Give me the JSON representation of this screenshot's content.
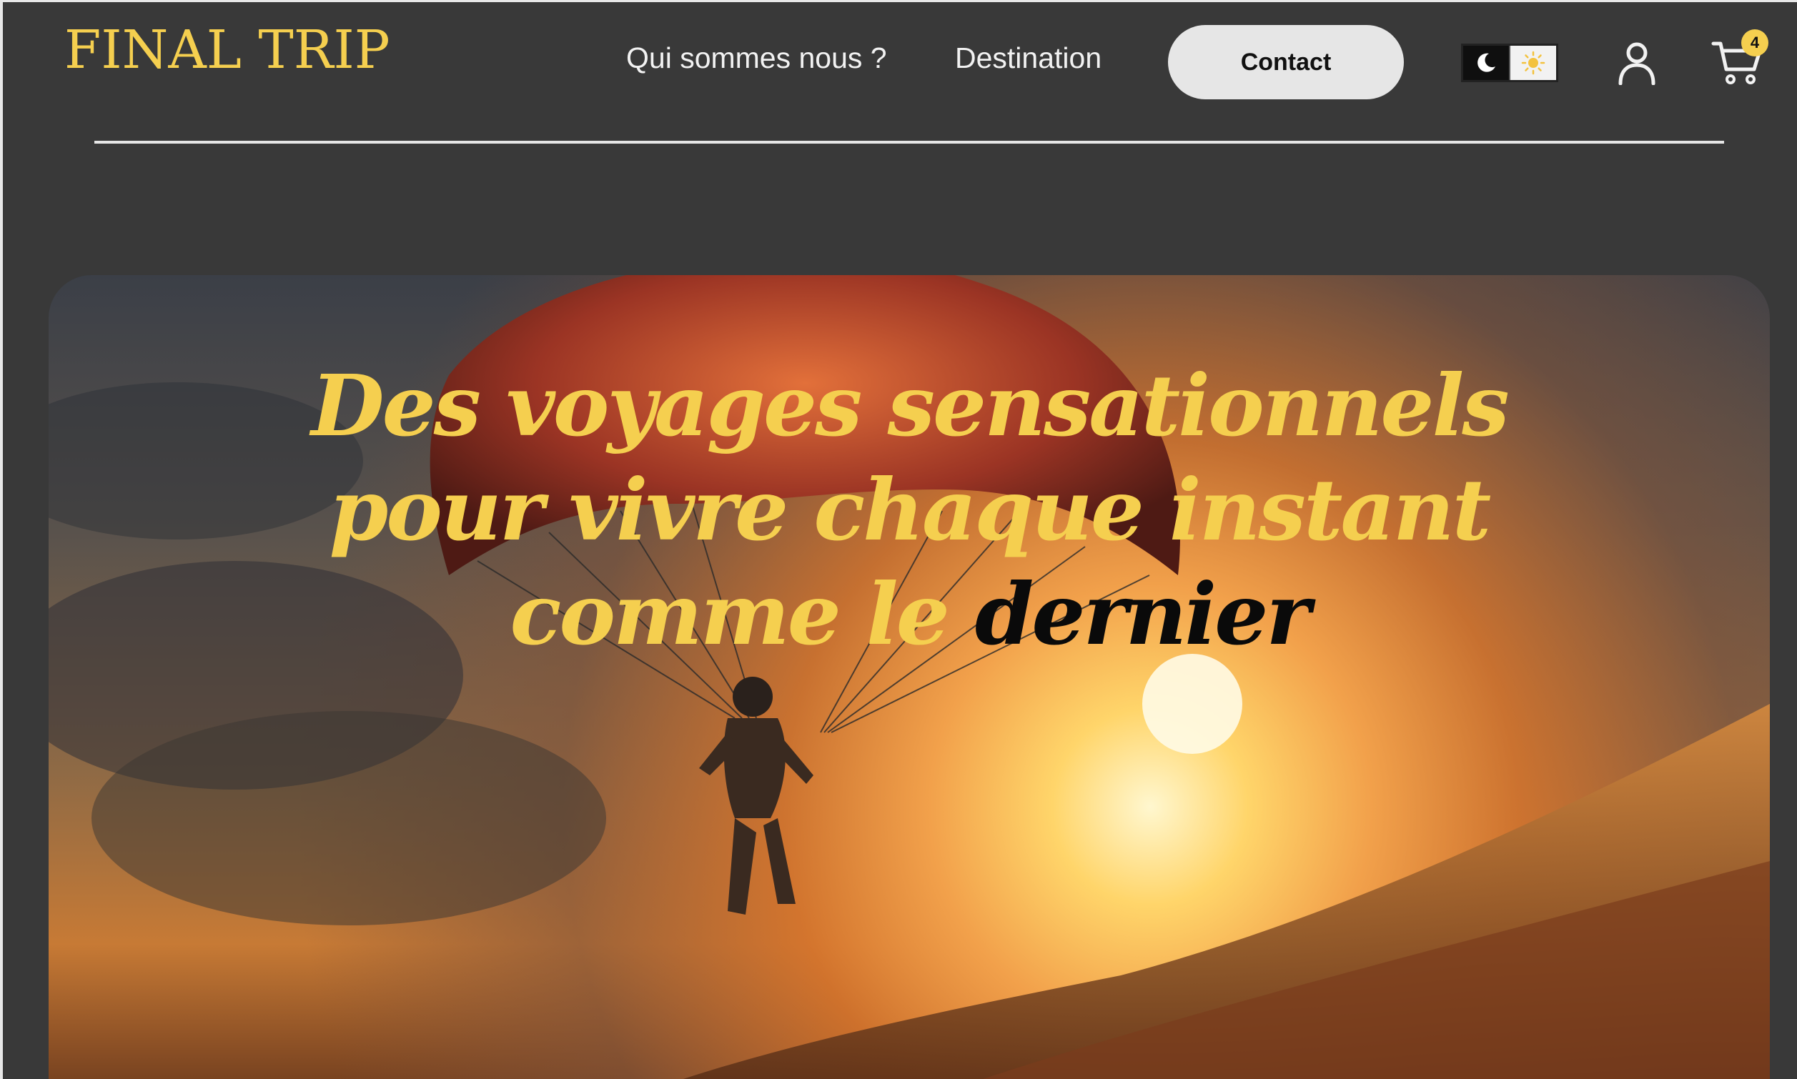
{
  "header": {
    "logo": "FINAL TRIP",
    "nav": [
      {
        "label": "Qui sommes nous ?"
      },
      {
        "label": "Destination"
      }
    ],
    "contact_label": "Contact",
    "cart_count": "4",
    "theme_toggle": {
      "dark_icon": "moon-icon",
      "light_icon": "sun-icon"
    },
    "user_icon": "user-icon",
    "cart_icon": "cart-icon"
  },
  "hero": {
    "title_line1": "Des voyages sensationnels",
    "title_line2": "pour vivre chaque instant",
    "title_line3_start": "comme le ",
    "title_highlight": "dernier"
  },
  "colors": {
    "accent": "#f5cf4f",
    "background": "#393939",
    "contact_button": "#e6e6e6"
  }
}
